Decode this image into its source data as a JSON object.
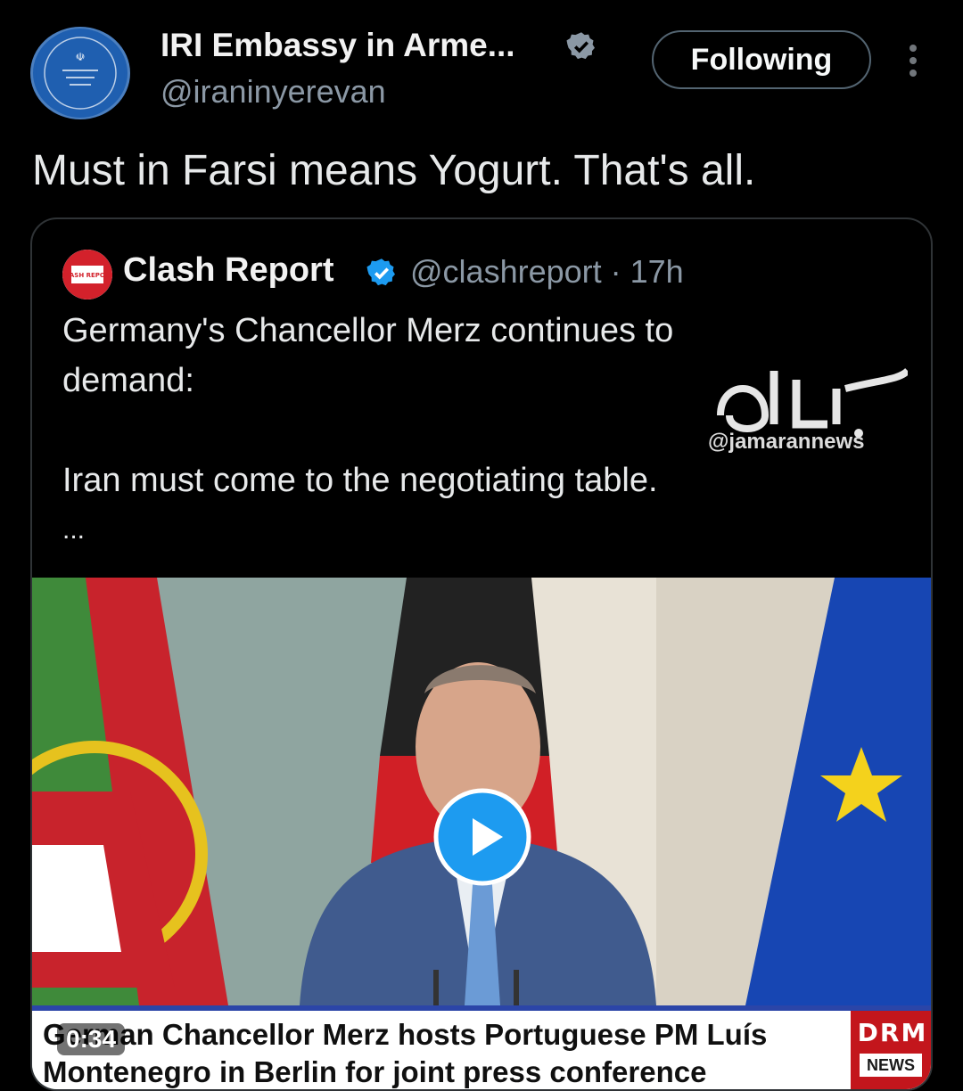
{
  "post": {
    "display_name": "IRI Embassy in Arme...",
    "handle": "@iraninyerevan",
    "follow_label": "Following",
    "text": "Must in Farsi means Yogurt. That's all."
  },
  "quote": {
    "display_name": "Clash Report",
    "handle_time": "@clashreport · 17h",
    "avatar_text": "CLASH REPORT",
    "lines": [
      "Germany's Chancellor Merz continues to",
      "demand:",
      "Iran must come to the negotiating table.",
      "..."
    ],
    "watermark": "@jamarannews"
  },
  "video": {
    "duration": "0:34",
    "ticker_line1": "German Chancellor Merz hosts Portuguese PM Luís",
    "ticker_line2": "Montenegro in Berlin for joint press conference",
    "logo_letters": "DRM",
    "logo_sub": "NEWS"
  },
  "colors": {
    "background": "#000000",
    "verified": "#1d9bf0",
    "muted": "#8b98a5",
    "ticker_border": "#2b45a8",
    "logo_red": "#c3161c"
  },
  "icons": {
    "verified": "verified-badge-icon",
    "more": "more-vertical-icon",
    "play": "play-icon"
  }
}
